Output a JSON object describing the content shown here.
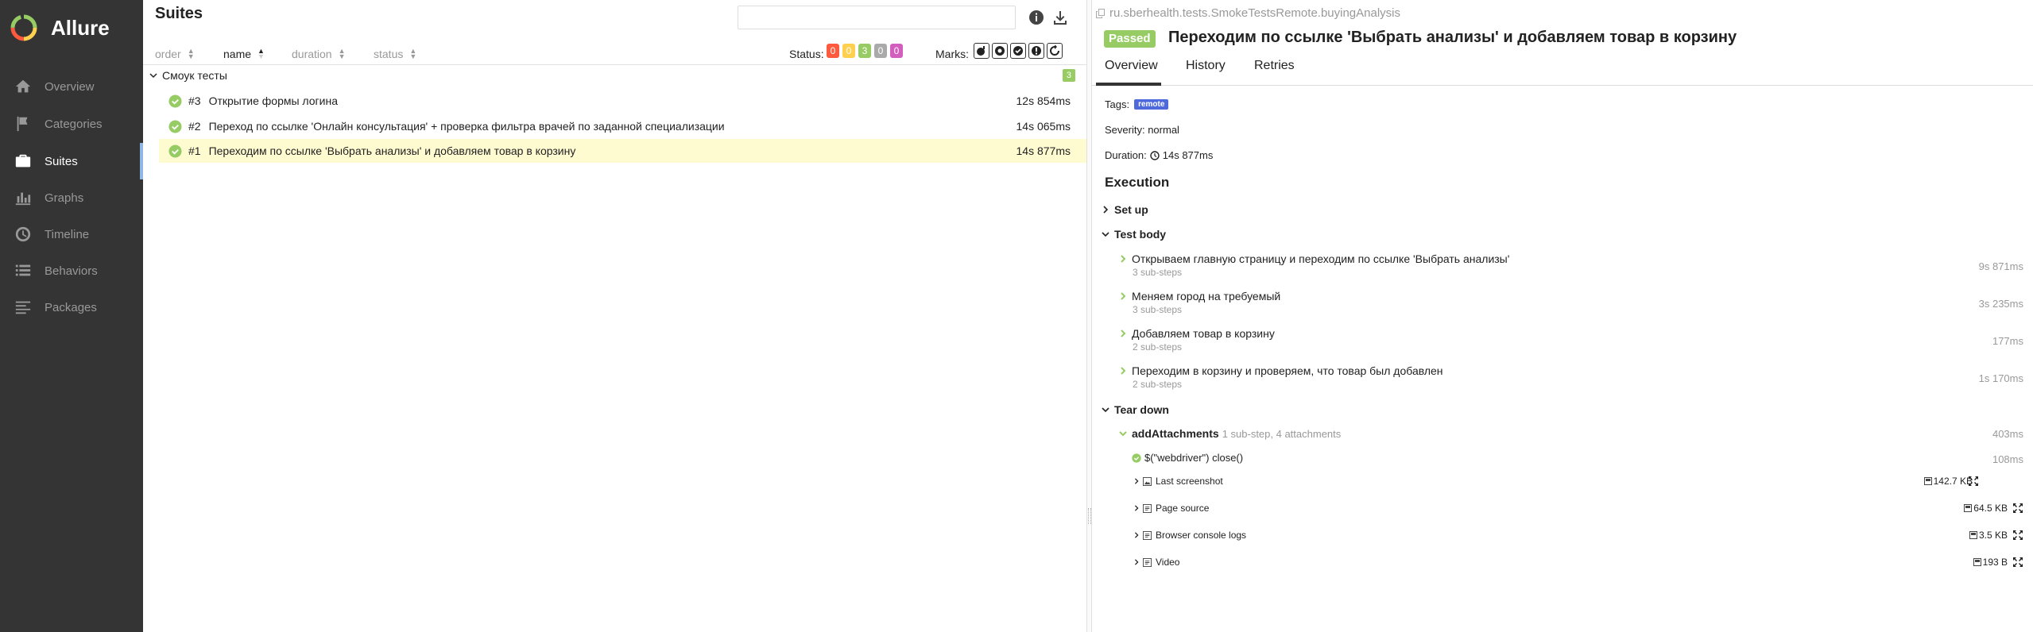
{
  "app": {
    "name": "Allure"
  },
  "nav": [
    {
      "label": "Overview",
      "icon": "home-icon"
    },
    {
      "label": "Categories",
      "icon": "flag-icon"
    },
    {
      "label": "Suites",
      "icon": "briefcase-icon",
      "active": true
    },
    {
      "label": "Graphs",
      "icon": "bar-chart-icon"
    },
    {
      "label": "Timeline",
      "icon": "clock-icon"
    },
    {
      "label": "Behaviors",
      "icon": "list-icon"
    },
    {
      "label": "Packages",
      "icon": "align-left-icon"
    }
  ],
  "suites": {
    "title": "Suites",
    "search": {
      "value": "",
      "placeholder": ""
    },
    "sort": {
      "order": "order",
      "name": "name",
      "duration": "duration",
      "status": "status",
      "active": "name"
    },
    "status_label": "Status:",
    "status_counts": [
      {
        "value": "0",
        "color": "#fd5a3e"
      },
      {
        "value": "0",
        "color": "#ffd050"
      },
      {
        "value": "3",
        "color": "#97cc64"
      },
      {
        "value": "0",
        "color": "#aaaaaa"
      },
      {
        "value": "0",
        "color": "#d35ebe"
      }
    ],
    "marks_label": "Marks:",
    "group": {
      "name": "Смоук тесты",
      "count": "3"
    },
    "tests": [
      {
        "num": "#3",
        "name": "Открытие формы логина",
        "duration": "12s 854ms"
      },
      {
        "num": "#2",
        "name": "Переход по ссылке 'Онлайн консультация' + проверка фильтра врачей по заданной специализации",
        "duration": "14s 065ms"
      },
      {
        "num": "#1",
        "name": "Переходим по ссылке 'Выбрать анализы' и добавляем товар в корзину",
        "duration": "14s 877ms",
        "selected": true
      }
    ]
  },
  "detail": {
    "fullname": "ru.sberhealth.tests.SmokeTestsRemote.buyingAnalysis",
    "status": "Passed",
    "title": "Переходим по ссылке 'Выбрать анализы' и добавляем товар в корзину",
    "tabs": [
      "Overview",
      "History",
      "Retries"
    ],
    "tags_label": "Tags:",
    "tag": "remote",
    "severity_label": "Severity:",
    "severity": "normal",
    "duration_label": "Duration:",
    "duration": "14s 877ms",
    "execution_title": "Execution",
    "setup_label": "Set up",
    "test_body_label": "Test body",
    "steps": [
      {
        "name": "Открываем главную страницу и переходим по ссылке 'Выбрать анализы'",
        "sub": "3 sub-steps",
        "duration": "9s 871ms"
      },
      {
        "name": "Меняем город на требуемый",
        "sub": "3 sub-steps",
        "duration": "3s 235ms"
      },
      {
        "name": "Добавляем товар в корзину",
        "sub": "2 sub-steps",
        "duration": "177ms"
      },
      {
        "name": "Переходим в корзину и проверяем, что товар был добавлен",
        "sub": "2 sub-steps",
        "duration": "1s 170ms"
      }
    ],
    "teardown_label": "Tear down",
    "teardown": {
      "name": "addAttachments",
      "sub": "1 sub-step, 4 attachments",
      "duration": "403ms",
      "substep": {
        "name": "$(\"webdriver\") close()",
        "duration": "108ms"
      },
      "attachments": [
        {
          "name": "Last screenshot",
          "size": "142.7 KB",
          "icon": "image-file-icon"
        },
        {
          "name": "Page source",
          "size": "64.5 KB",
          "icon": "text-file-icon"
        },
        {
          "name": "Browser console logs",
          "size": "3.5 KB",
          "icon": "text-file-icon"
        },
        {
          "name": "Video",
          "size": "193 B",
          "icon": "text-file-icon"
        }
      ]
    }
  }
}
